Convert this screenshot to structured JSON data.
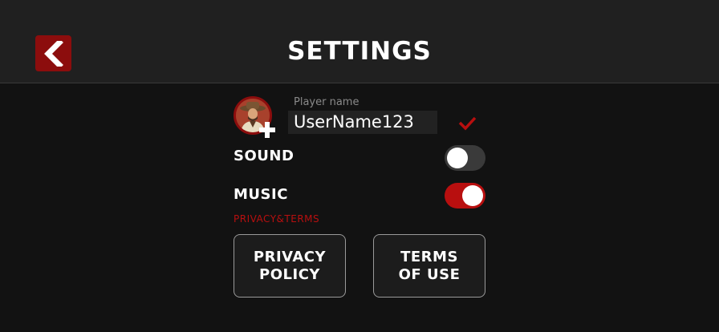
{
  "header": {
    "title": "SETTINGS",
    "back_icon": "chevron-left-icon"
  },
  "profile": {
    "player_name_label": "Player name",
    "player_name_value": "UserName123",
    "avatar_icon": "cowboy-avatar",
    "add_avatar_icon": "plus-icon",
    "confirm_icon": "check-icon"
  },
  "settings": {
    "sound": {
      "label": "SOUND",
      "enabled": false
    },
    "music": {
      "label": "MUSIC",
      "enabled": true
    }
  },
  "legal": {
    "section_label": "PRIVACY&TERMS",
    "privacy_button": "PRIVACY\nPOLICY",
    "terms_button": "TERMS\nOF USE"
  },
  "colors": {
    "accent": "#b80f0f",
    "accent_dark": "#8c0d0d",
    "background": "#121212",
    "header": "#202020"
  }
}
